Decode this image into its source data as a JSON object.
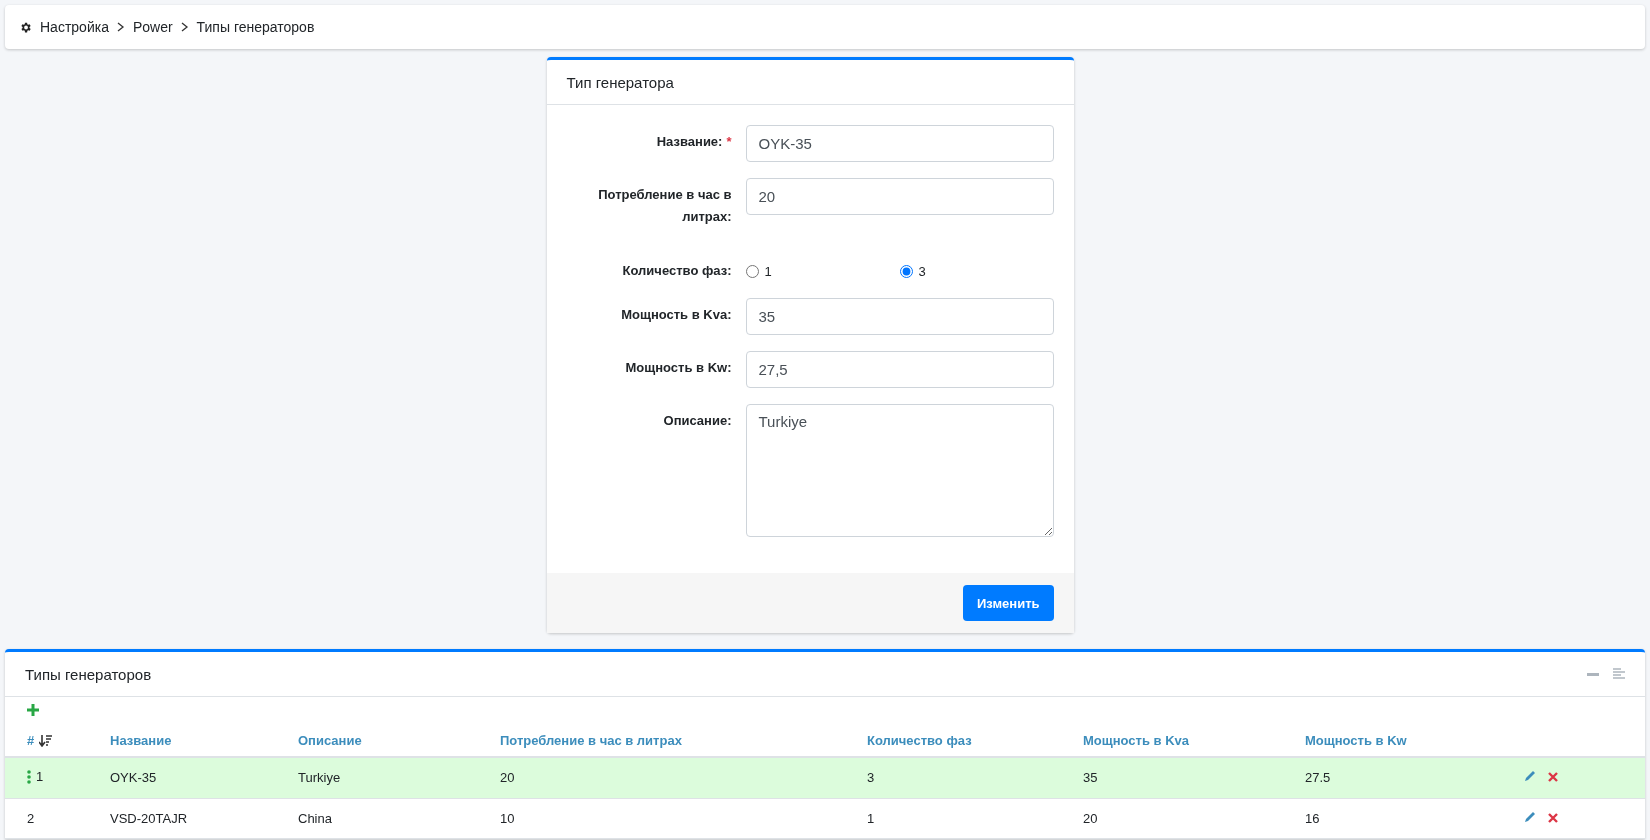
{
  "breadcrumb": [
    "Настройка",
    "Power",
    "Типы генераторов"
  ],
  "form": {
    "title": "Тип генератора",
    "fields": [
      {
        "kind": "input",
        "label": "Название:",
        "marker": "*",
        "value": "OYK-35"
      },
      {
        "kind": "input",
        "label": "Потребление в час в литрах:",
        "value": "20"
      },
      {
        "kind": "radio",
        "label": "Количество фаз:",
        "options": [
          {
            "label": "1",
            "selected": false
          },
          {
            "label": "3",
            "selected": true
          }
        ]
      },
      {
        "kind": "input",
        "label": "Мощность в Kva:",
        "value": "35"
      },
      {
        "kind": "input",
        "label": "Мощность в Kw:",
        "value": "27,5"
      },
      {
        "kind": "textarea",
        "label": "Описание:",
        "value": "Turkiye"
      }
    ],
    "submit": "Изменить"
  },
  "table": {
    "title": "Типы генераторов",
    "columns": [
      "#",
      "Название",
      "Описание",
      "Потребление в час в литрах",
      "Количество фаз",
      "Мощность в Kva",
      "Мощность в Kw"
    ],
    "rows": [
      {
        "selected": true,
        "cells": [
          "1",
          "OYK-35",
          "Turkiye",
          "20",
          "3",
          "35",
          "27.5"
        ]
      },
      {
        "selected": false,
        "cells": [
          "2",
          "VSD-20TAJR",
          "China",
          "10",
          "1",
          "20",
          "16"
        ]
      }
    ]
  }
}
